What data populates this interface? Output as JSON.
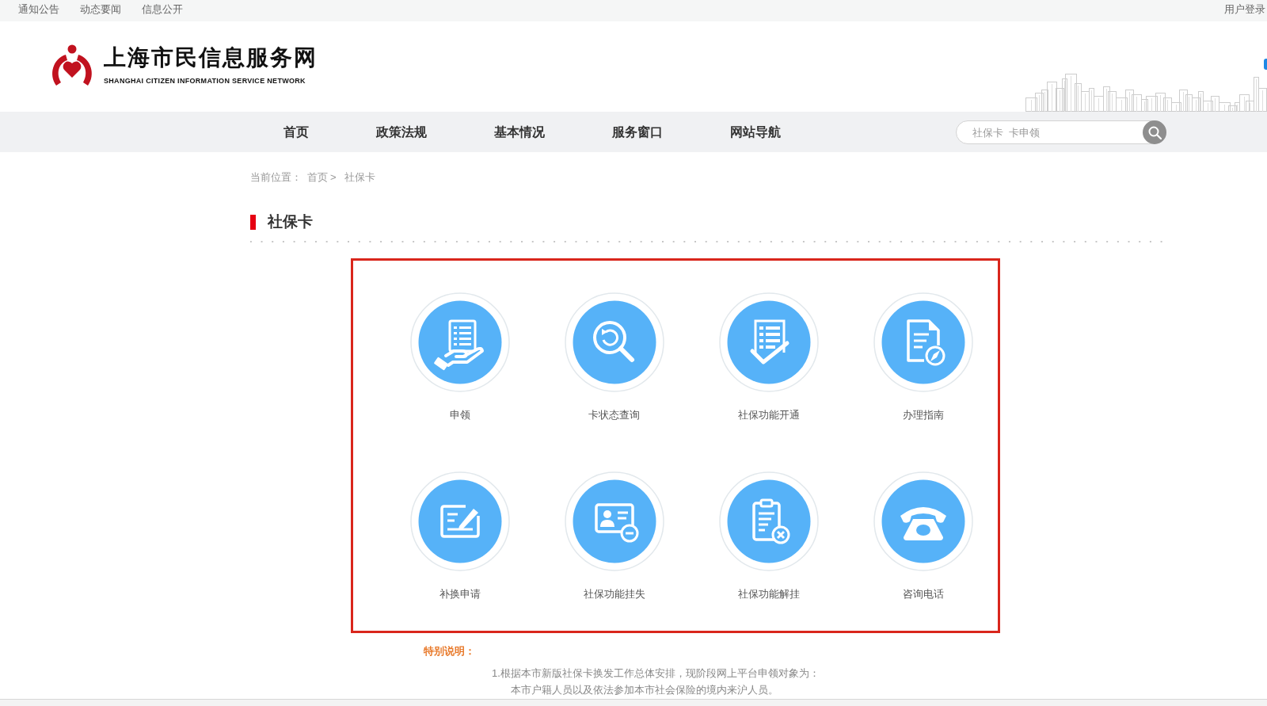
{
  "top_bar": {
    "links": [
      "通知公告",
      "动态要闻",
      "信息公开"
    ],
    "login": "用户登录"
  },
  "header": {
    "title": "上海市民信息服务网",
    "subtitle": "SHANGHAI CITIZEN INFORMATION SERVICE NETWORK"
  },
  "nav": {
    "items": [
      "首页",
      "政策法规",
      "基本情况",
      "服务窗口",
      "网站导航"
    ],
    "search": {
      "placeholder": "社保卡  卡申领"
    }
  },
  "breadcrumb": {
    "label": "当前位置：",
    "items": [
      "首页",
      "社保卡"
    ],
    "separator": ">"
  },
  "page_title": "社保卡",
  "services": [
    {
      "label": "申领",
      "kind": "hand"
    },
    {
      "label": "卡状态查询",
      "kind": "magnifier"
    },
    {
      "label": "社保功能开通",
      "kind": "checklist"
    },
    {
      "label": "办理指南",
      "kind": "compass"
    },
    {
      "label": "补换申请",
      "kind": "pen"
    },
    {
      "label": "社保功能挂失",
      "kind": "idcard"
    },
    {
      "label": "社保功能解挂",
      "kind": "clipboard"
    },
    {
      "label": "咨询电话",
      "kind": "phone"
    }
  ],
  "notice": {
    "title": "特别说明：",
    "items": [
      {
        "text": "1.根据本市新版社保卡换发工作总体安排，现阶段网上平台申领对象为：",
        "detail": "本市户籍人员以及依法参加本市社会保险的境内来沪人员。"
      }
    ]
  }
}
